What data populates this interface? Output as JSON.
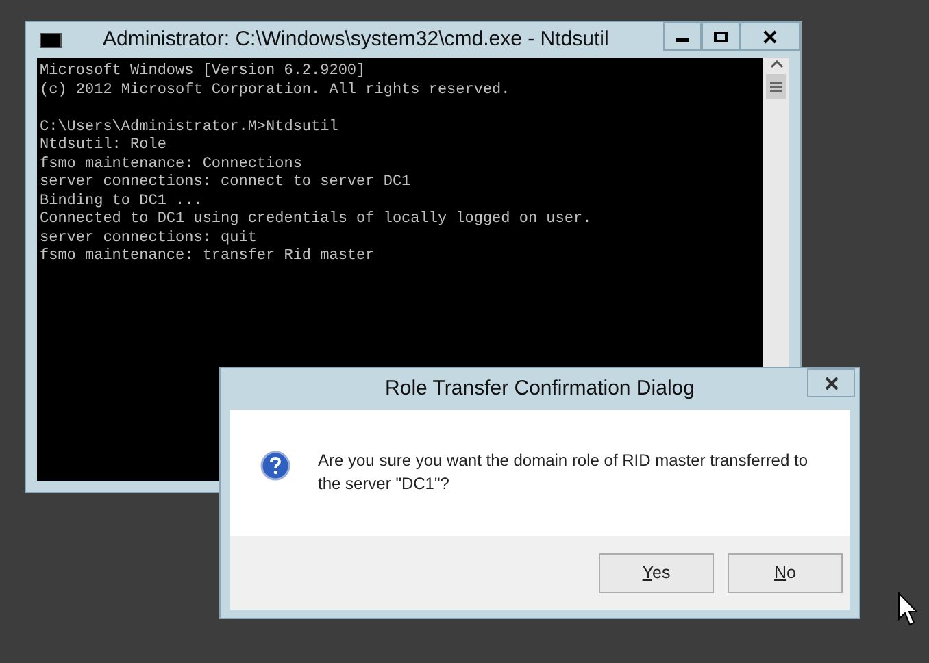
{
  "console_window": {
    "title": "Administrator: C:\\Windows\\system32\\cmd.exe - Ntdsutil",
    "blocks": [
      [
        "Microsoft Windows [Version 6.2.9200]",
        "(c) 2012 Microsoft Corporation. All rights reserved."
      ],
      [
        "C:\\Users\\Administrator.M>Ntdsutil",
        "Ntdsutil: Role",
        "fsmo maintenance: Connections",
        "server connections: connect to server DC1",
        "Binding to DC1 ...",
        "Connected to DC1 using credentials of locally logged on user.",
        "server connections: quit",
        "fsmo maintenance: transfer Rid master"
      ]
    ]
  },
  "dialog": {
    "title": "Role Transfer Confirmation Dialog",
    "message": "Are you sure you want the domain role of RID master transferred to the server \"DC1\"?",
    "buttons": [
      {
        "label": "Yes"
      },
      {
        "label": "No"
      }
    ]
  }
}
